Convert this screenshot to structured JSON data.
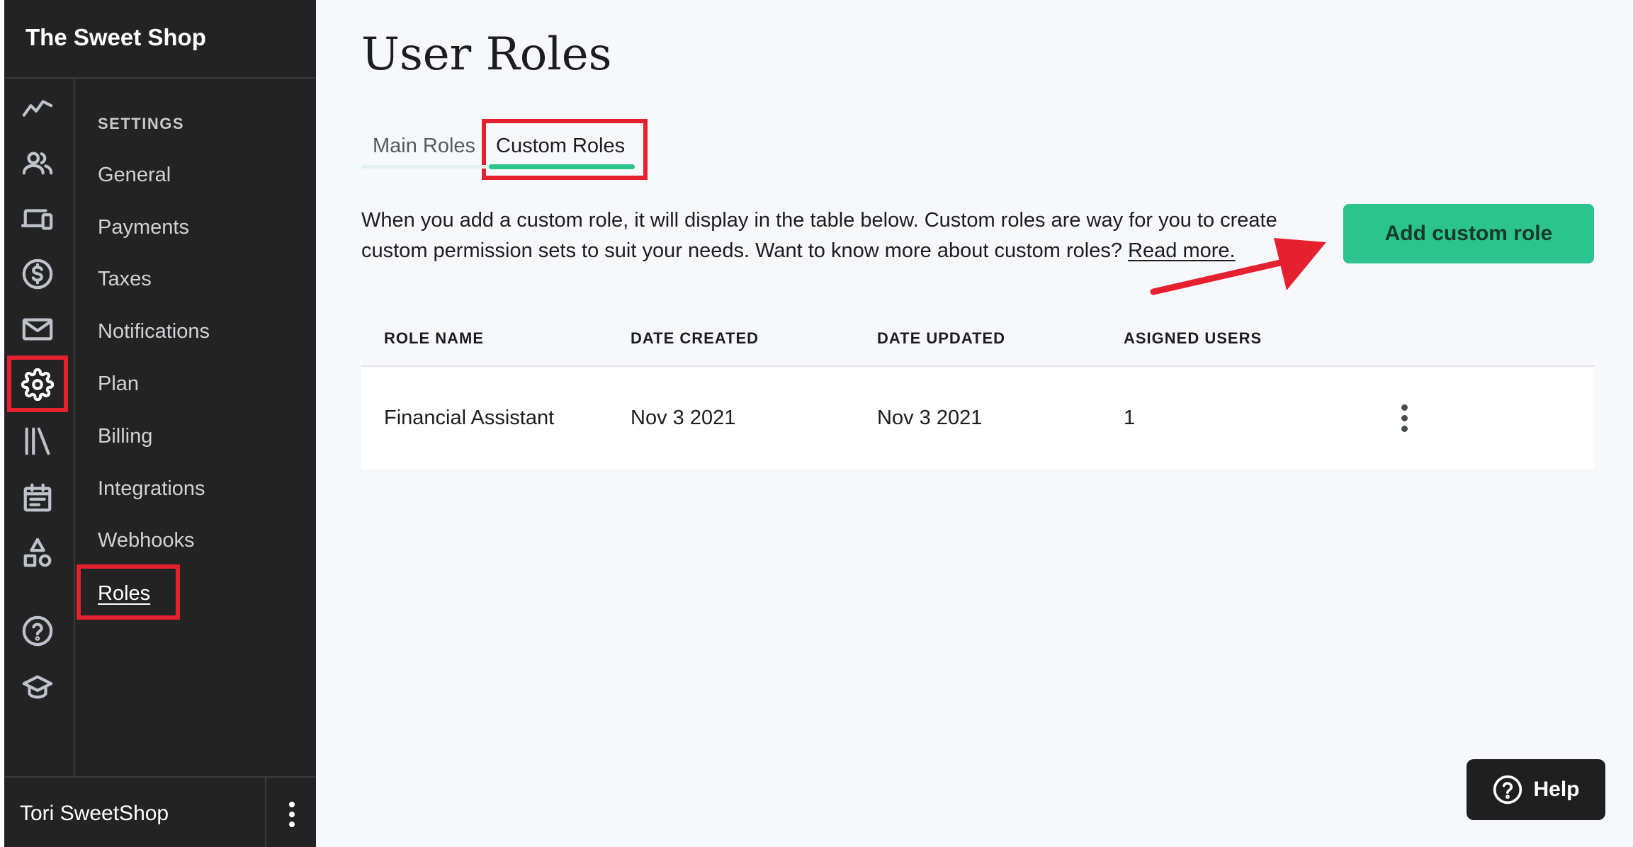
{
  "sidebar": {
    "shop_name": "The Sweet Shop",
    "rail_icons": [
      "analytics-icon",
      "customers-icon",
      "devices-icon",
      "dollar-icon",
      "mail-icon",
      "gear-icon",
      "library-icon",
      "calendar-icon",
      "shapes-icon",
      "help-circle-icon",
      "graduation-cap-icon"
    ],
    "active_rail_icon": "gear-icon",
    "settings_heading": "SETTINGS",
    "menu": [
      {
        "label": "General"
      },
      {
        "label": "Payments"
      },
      {
        "label": "Taxes"
      },
      {
        "label": "Notifications"
      },
      {
        "label": "Plan"
      },
      {
        "label": "Billing"
      },
      {
        "label": "Integrations"
      },
      {
        "label": "Webhooks"
      },
      {
        "label": "Roles"
      }
    ],
    "active_menu": "Roles",
    "user_name": "Tori SweetShop"
  },
  "main": {
    "title": "User Roles",
    "tabs": [
      {
        "label": "Main Roles"
      },
      {
        "label": "Custom Roles"
      }
    ],
    "active_tab": "Custom Roles",
    "intro_text": "When you add a custom role, it will display in the table below. Custom roles are way for you to create custom permission sets to suit your needs. Want to know more about custom roles?",
    "intro_link": "Read more.",
    "add_button_label": "Add custom role",
    "table": {
      "headers": [
        "ROLE NAME",
        "DATE CREATED",
        "DATE UPDATED",
        "ASIGNED USERS"
      ],
      "rows": [
        [
          "Financial Assistant",
          "Nov 3 2021",
          "Nov 3 2021",
          "1"
        ]
      ]
    },
    "help_label": "Help"
  },
  "colors": {
    "sidebar_bg": "#232323",
    "accent_green": "#2bc48e",
    "highlight_red": "#e5202f",
    "page_bg": "#f7f8fb"
  }
}
